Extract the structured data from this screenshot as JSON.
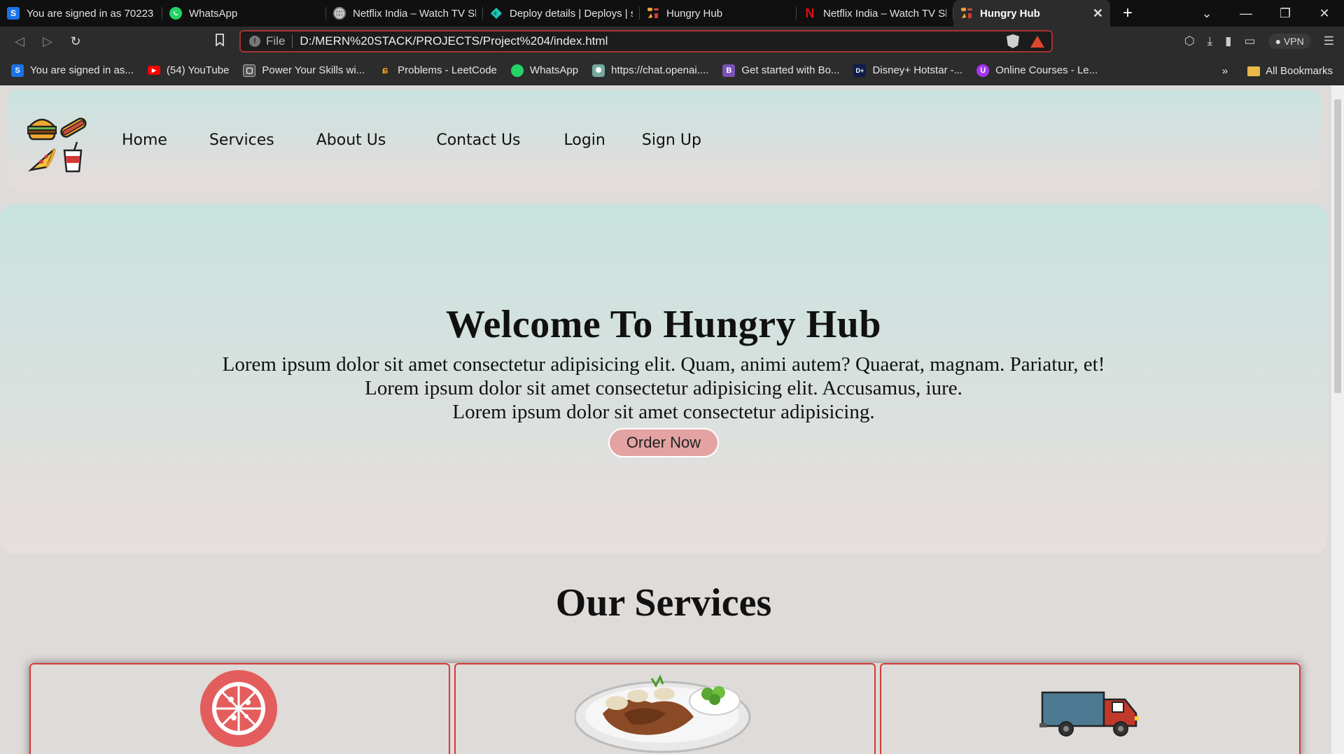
{
  "browser": {
    "tabs": [
      {
        "title": "You are signed in as 70223",
        "icon": "s-logo-icon",
        "color": "#1a73e8"
      },
      {
        "title": "WhatsApp",
        "icon": "whatsapp-icon",
        "color": "#25d366"
      },
      {
        "title": "Netflix India – Watch TV Sh",
        "icon": "globe-icon",
        "color": "#888888"
      },
      {
        "title": "Deploy details | Deploys | s",
        "icon": "netlify-icon",
        "color": "#20c6b7"
      },
      {
        "title": "Hungry Hub",
        "icon": "hungry-hub-icon",
        "color": "#e8a030"
      },
      {
        "title": "Netflix India – Watch TV Sh",
        "icon": "netflix-icon",
        "color": "#e50914"
      },
      {
        "title": "Hungry Hub",
        "icon": "hungry-hub-icon",
        "color": "#e8a030"
      }
    ],
    "url_scheme_label": "File",
    "url": "D:/MERN%20STACK/PROJECTS/Project%204/index.html",
    "vpn_label": "VPN",
    "bookmarks": [
      {
        "label": "You are signed in as...",
        "icon": "s-logo-icon",
        "color": "#1a73e8"
      },
      {
        "label": "(54) YouTube",
        "icon": "youtube-icon",
        "color": "#ff0000"
      },
      {
        "label": "Power Your Skills wi...",
        "icon": "page-icon",
        "color": "#555555"
      },
      {
        "label": "Problems - LeetCode",
        "icon": "leetcode-icon",
        "color": "#f89f1b"
      },
      {
        "label": "WhatsApp",
        "icon": "whatsapp-icon",
        "color": "#25d366"
      },
      {
        "label": "https://chat.openai....",
        "icon": "openai-icon",
        "color": "#74aa9c"
      },
      {
        "label": "Get started with Bo...",
        "icon": "bootstrap-icon",
        "color": "#7952b3"
      },
      {
        "label": "Disney+ Hotstar -...",
        "icon": "hotstar-icon",
        "color": "#0f1c4d"
      },
      {
        "label": "Online Courses - Le...",
        "icon": "udemy-icon",
        "color": "#a435f0"
      }
    ],
    "bookmarks_overflow": "»",
    "all_bookmarks_label": "All Bookmarks"
  },
  "site": {
    "nav": [
      "Home",
      "Services",
      "About Us",
      "Contact Us",
      "Login",
      "Sign Up"
    ],
    "hero": {
      "title": "Welcome To Hungry Hub",
      "lines": [
        "Lorem ipsum dolor sit amet consectetur adipisicing elit. Quam, animi autem? Quaerat, magnam. Pariatur, et!",
        "Lorem ipsum dolor sit amet consectetur adipisicing elit. Accusamus, iure.",
        "Lorem ipsum dolor sit amet consectetur adipisicing."
      ],
      "button": "Order Now"
    },
    "services_title": "Our Services",
    "cards": [
      {
        "icon": "pizza-icon"
      },
      {
        "icon": "food-plate-icon"
      },
      {
        "icon": "delivery-truck-icon"
      }
    ]
  }
}
